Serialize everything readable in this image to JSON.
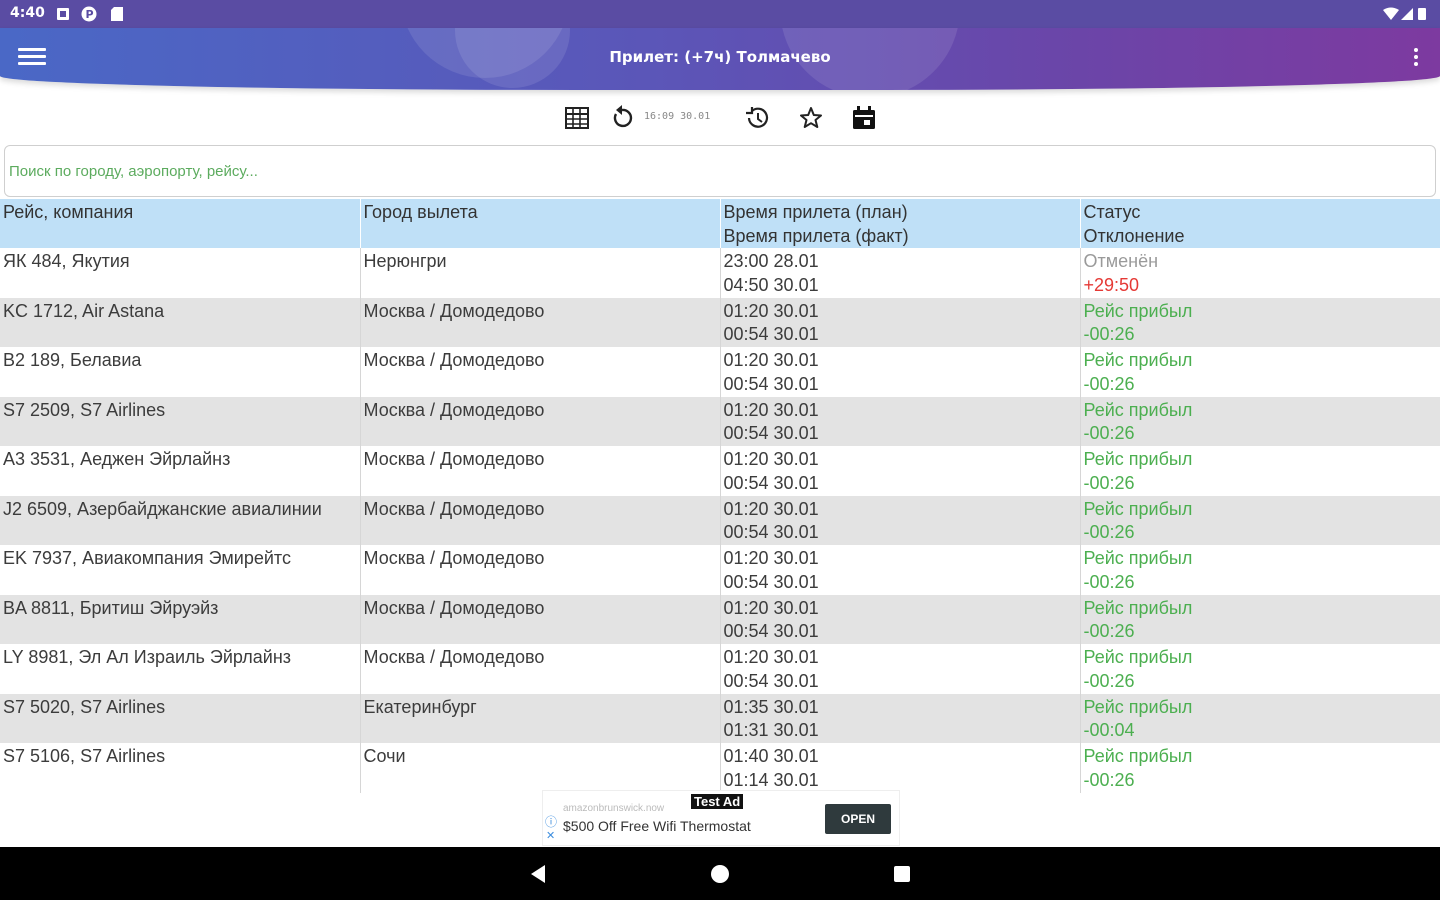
{
  "status_bar": {
    "time": "4:40"
  },
  "appbar": {
    "title": "Прилет: (+7ч) Толмачево"
  },
  "toolbar": {
    "timestamp": "16:09 30.01"
  },
  "search": {
    "placeholder": "Поиск по городу, аэропорту, рейсу...",
    "value": ""
  },
  "table": {
    "headers": [
      {
        "line1": "Рейс, компания",
        "line2": ""
      },
      {
        "line1": "Город вылета",
        "line2": ""
      },
      {
        "line1": "Время прилета (план)",
        "line2": "Время прилета (факт)"
      },
      {
        "line1": "Статус",
        "line2": "Отклонение"
      }
    ],
    "rows": [
      {
        "flight": "ЯК 484, Якутия",
        "city": "Нерюнгри",
        "plan": "23:00 28.01",
        "fact": "04:50 30.01",
        "status": "Отменён",
        "deviation": "+29:50",
        "status_kind": "grey",
        "dev_kind": "red"
      },
      {
        "flight": "KC 1712, Air Astana",
        "city": "Москва / Домодедово",
        "plan": "01:20 30.01",
        "fact": "00:54 30.01",
        "status": "Рейс прибыл",
        "deviation": "-00:26",
        "status_kind": "green",
        "dev_kind": "green"
      },
      {
        "flight": "B2 189, Белавиа",
        "city": "Москва / Домодедово",
        "plan": "01:20 30.01",
        "fact": "00:54 30.01",
        "status": "Рейс прибыл",
        "deviation": "-00:26",
        "status_kind": "green",
        "dev_kind": "green"
      },
      {
        "flight": "S7 2509, S7 Airlines",
        "city": "Москва / Домодедово",
        "plan": "01:20 30.01",
        "fact": "00:54 30.01",
        "status": "Рейс прибыл",
        "deviation": "-00:26",
        "status_kind": "green",
        "dev_kind": "green"
      },
      {
        "flight": "A3 3531, Аеджен Эйрлайнз",
        "city": "Москва / Домодедово",
        "plan": "01:20 30.01",
        "fact": "00:54 30.01",
        "status": "Рейс прибыл",
        "deviation": "-00:26",
        "status_kind": "green",
        "dev_kind": "green"
      },
      {
        "flight": "J2 6509, Азербайджанские авиалинии",
        "city": "Москва / Домодедово",
        "plan": "01:20 30.01",
        "fact": "00:54 30.01",
        "status": "Рейс прибыл",
        "deviation": "-00:26",
        "status_kind": "green",
        "dev_kind": "green"
      },
      {
        "flight": "EK 7937, Авиакомпания Эмирейтс",
        "city": "Москва / Домодедово",
        "plan": "01:20 30.01",
        "fact": "00:54 30.01",
        "status": "Рейс прибыл",
        "deviation": "-00:26",
        "status_kind": "green",
        "dev_kind": "green"
      },
      {
        "flight": "BA 8811, Бритиш Эйруэйз",
        "city": "Москва / Домодедово",
        "plan": "01:20 30.01",
        "fact": "00:54 30.01",
        "status": "Рейс прибыл",
        "deviation": "-00:26",
        "status_kind": "green",
        "dev_kind": "green"
      },
      {
        "flight": "LY 8981, Эл Ал Израиль Эйрлайнз",
        "city": "Москва / Домодедово",
        "plan": "01:20 30.01",
        "fact": "00:54 30.01",
        "status": "Рейс прибыл",
        "deviation": "-00:26",
        "status_kind": "green",
        "dev_kind": "green"
      },
      {
        "flight": "S7 5020, S7 Airlines",
        "city": "Екатеринбург",
        "plan": "01:35 30.01",
        "fact": "01:31 30.01",
        "status": "Рейс прибыл",
        "deviation": "-00:04",
        "status_kind": "green",
        "dev_kind": "green"
      },
      {
        "flight": "S7 5106, S7 Airlines",
        "city": "Сочи",
        "plan": "01:40 30.01",
        "fact": "01:14 30.01",
        "status": "Рейс прибыл",
        "deviation": "-00:26",
        "status_kind": "green",
        "dev_kind": "green"
      }
    ]
  },
  "ad": {
    "label": "Test Ad",
    "domain": "amazonbrunswick.now",
    "text": "$500 Off Free Wifi Thermostat",
    "button": "OPEN"
  },
  "colors": {
    "header_bg": "#bfe0f7",
    "status_green": "#4caf50",
    "deviation_red": "#e53935",
    "appbar_start": "#4a68c6",
    "appbar_end": "#7d3aa0"
  }
}
